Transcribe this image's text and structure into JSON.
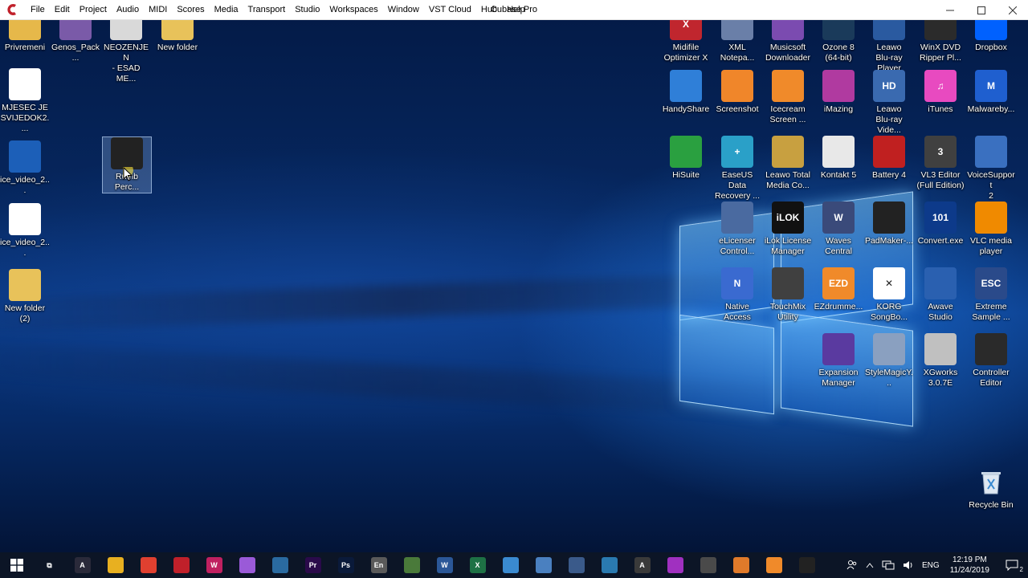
{
  "window": {
    "title": "Cubase Pro"
  },
  "menu": [
    "File",
    "Edit",
    "Project",
    "Audio",
    "MIDI",
    "Scores",
    "Media",
    "Transport",
    "Studio",
    "Workspaces",
    "Window",
    "VST Cloud",
    "Hub",
    "Help"
  ],
  "desktop_left": [
    {
      "label": "Privremeni",
      "color": "#e6b84a"
    },
    {
      "label": "Genos_Pack...",
      "color": "#7a5aa8"
    },
    {
      "label": "NEOZENJEN\n- ESAD ME...",
      "color": "#d9d9d9"
    },
    {
      "label": "New folder",
      "color": "#e8c25a"
    },
    {
      "label": "MJESEC JE\nSVIJEDOK2....",
      "color": "#ffffff"
    },
    {
      "label": "ice_video_2...",
      "color": "#1c5fb8"
    },
    {
      "label": "Rumb Perc...",
      "color": "#222222"
    },
    {
      "label": "ice_video_2...",
      "color": "#ffffff"
    },
    {
      "label": "New folder\n(2)",
      "color": "#e8c25a"
    }
  ],
  "desktop_right": [
    {
      "label": "Midifile\nOptimizer X",
      "color": "#c0262e",
      "glyph": "X"
    },
    {
      "label": "XML\nNotepa...",
      "color": "#6a7fa8",
      "glyph": ""
    },
    {
      "label": "Musicsoft\nDownloader",
      "color": "#7b4bb0",
      "glyph": ""
    },
    {
      "label": "Ozone 8\n(64-bit)",
      "color": "#1a3a5a",
      "glyph": ""
    },
    {
      "label": "Leawo\nBlu-ray Player",
      "color": "#2a5aa0",
      "glyph": ""
    },
    {
      "label": "WinX DVD\nRipper Pl...",
      "color": "#2b2b2b",
      "glyph": ""
    },
    {
      "label": "Dropbox",
      "color": "#0061fe",
      "glyph": ""
    },
    {
      "label": "HandyShare",
      "color": "#2f7fd8",
      "glyph": ""
    },
    {
      "label": "Screenshot",
      "color": "#f0862a",
      "glyph": ""
    },
    {
      "label": "Icecream\nScreen ...",
      "color": "#f08a2a",
      "glyph": ""
    },
    {
      "label": "iMazing",
      "color": "#b03aa0",
      "glyph": ""
    },
    {
      "label": "Leawo\nBlu-ray Vide...",
      "color": "#3a6ab0",
      "glyph": "HD"
    },
    {
      "label": "iTunes",
      "color": "#e84ac0",
      "glyph": "♫"
    },
    {
      "label": "Malwareby...",
      "color": "#1f5fcf",
      "glyph": "M"
    },
    {
      "label": "HiSuite",
      "color": "#2aa040",
      "glyph": ""
    },
    {
      "label": "EaseUS Data\nRecovery ...",
      "color": "#2aa0c8",
      "glyph": "+"
    },
    {
      "label": "Leawo Total\nMedia Co...",
      "color": "#c8a040",
      "glyph": ""
    },
    {
      "label": "Kontakt 5",
      "color": "#e8e8e8",
      "glyph": ""
    },
    {
      "label": "Battery 4",
      "color": "#c02020",
      "glyph": ""
    },
    {
      "label": "VL3 Editor\n(Full Edition)",
      "color": "#404040",
      "glyph": "3"
    },
    {
      "label": "VoiceSupport\n2",
      "color": "#3a70c0",
      "glyph": ""
    },
    {
      "label": "eLicenser\nControl...",
      "color": "#4a6aa0",
      "glyph": ""
    },
    {
      "label": "iLok License\nManager",
      "color": "#111111",
      "glyph": "iLOK"
    },
    {
      "label": "Waves\nCentral",
      "color": "#3a4a7a",
      "glyph": "W"
    },
    {
      "label": "PadMaker-...",
      "color": "#222222",
      "glyph": ""
    },
    {
      "label": "Convert.exe",
      "color": "#0d3a8a",
      "glyph": "101"
    },
    {
      "label": "VLC media\nplayer",
      "color": "#f08a00",
      "glyph": ""
    },
    {
      "label": "Native Access",
      "color": "#3a6ad0",
      "glyph": "N"
    },
    {
      "label": "TouchMix\nUtility",
      "color": "#404040",
      "glyph": ""
    },
    {
      "label": "EZdrumme...",
      "color": "#f08a2a",
      "glyph": "EZD"
    },
    {
      "label": "KORG\nSongBo...",
      "color": "#ffffff",
      "glyph": "✕"
    },
    {
      "label": "Awave Studio",
      "color": "#2a60b0",
      "glyph": ""
    },
    {
      "label": "Extreme\nSample ...",
      "color": "#2a4a8a",
      "glyph": "ESC"
    },
    {
      "label": "Expansion\nManager",
      "color": "#5a3aa0",
      "glyph": ""
    },
    {
      "label": "StyleMagicY...",
      "color": "#8aa0c0",
      "glyph": ""
    },
    {
      "label": "XGworks\n3.0.7E",
      "color": "#c0c0c0",
      "glyph": ""
    },
    {
      "label": "Controller\nEditor",
      "color": "#2a2a2a",
      "glyph": ""
    }
  ],
  "recycle": {
    "label": "Recycle Bin"
  },
  "taskbar": {
    "apps": [
      {
        "name": "task-view",
        "color": "#0c1526",
        "glyph": "⧉"
      },
      {
        "name": "avid",
        "color": "#2a2a3a",
        "glyph": "A"
      },
      {
        "name": "file-explorer",
        "color": "#e8b020",
        "glyph": ""
      },
      {
        "name": "chrome",
        "color": "#e04030",
        "glyph": ""
      },
      {
        "name": "cubase",
        "color": "#c0202a",
        "glyph": ""
      },
      {
        "name": "wavelab",
        "color": "#c02060",
        "glyph": "W"
      },
      {
        "name": "mixer",
        "color": "#9a5ad8",
        "glyph": ""
      },
      {
        "name": "helper",
        "color": "#2a6aa0",
        "glyph": ""
      },
      {
        "name": "premiere",
        "color": "#2a0a4a",
        "glyph": "Pr"
      },
      {
        "name": "photoshop",
        "color": "#0a1a3a",
        "glyph": "Ps"
      },
      {
        "name": "encore",
        "color": "#5a5a5a",
        "glyph": "En"
      },
      {
        "name": "app-green",
        "color": "#4a7a3a",
        "glyph": ""
      },
      {
        "name": "word",
        "color": "#2b5797",
        "glyph": "W"
      },
      {
        "name": "excel",
        "color": "#1e7145",
        "glyph": "X"
      },
      {
        "name": "app-globe",
        "color": "#3a8ad0",
        "glyph": ""
      },
      {
        "name": "app-tool",
        "color": "#4a80c0",
        "glyph": ""
      },
      {
        "name": "app-pen",
        "color": "#3a5a8a",
        "glyph": ""
      },
      {
        "name": "app-screen",
        "color": "#2a7ab0",
        "glyph": ""
      },
      {
        "name": "app-a",
        "color": "#3a3a3a",
        "glyph": "A"
      },
      {
        "name": "app-bars",
        "color": "#a030c0",
        "glyph": ""
      },
      {
        "name": "app-car",
        "color": "#4a4a4a",
        "glyph": ""
      },
      {
        "name": "app-orange1",
        "color": "#e07a2a",
        "glyph": ""
      },
      {
        "name": "app-orange2",
        "color": "#f08a2a",
        "glyph": ""
      },
      {
        "name": "app-pad",
        "color": "#222222",
        "glyph": ""
      }
    ],
    "lang": "ENG",
    "time": "12:19 PM",
    "date": "11/24/2019",
    "notif_count": "2"
  }
}
